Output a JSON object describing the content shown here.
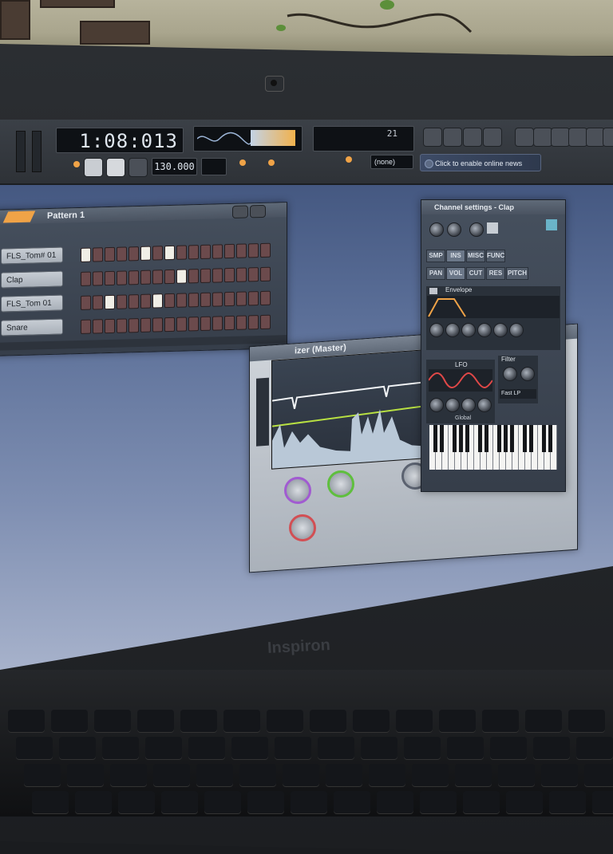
{
  "toolbar": {
    "time": "1:08:013",
    "tempo": "130.000",
    "channel_preset": "(none)",
    "news": "Click to enable online news",
    "hint_top": "21"
  },
  "pattern": {
    "title": "Pattern 1",
    "channels": [
      {
        "name": "FLS_Tom# 01",
        "steps": [
          1,
          0,
          0,
          0,
          0,
          1,
          0,
          1,
          0,
          0,
          0,
          0,
          0,
          0,
          0,
          0
        ]
      },
      {
        "name": "Clap",
        "steps": [
          0,
          0,
          0,
          0,
          0,
          0,
          0,
          0,
          1,
          0,
          0,
          0,
          0,
          0,
          0,
          0
        ]
      },
      {
        "name": "FLS_Tom 01",
        "steps": [
          0,
          0,
          1,
          0,
          0,
          0,
          1,
          0,
          0,
          0,
          0,
          0,
          0,
          0,
          0,
          0
        ]
      },
      {
        "name": "Snare",
        "steps": [
          0,
          0,
          0,
          0,
          0,
          0,
          0,
          0,
          0,
          0,
          0,
          0,
          0,
          0,
          0,
          0
        ]
      }
    ]
  },
  "channel_settings": {
    "title": "Channel settings - Clap",
    "tabs_row1": [
      "SMP",
      "INS",
      "MISC",
      "FUNC"
    ],
    "tabs_row2": [
      "PAN",
      "VOL",
      "CUT",
      "RES",
      "PITCH"
    ],
    "envelope_label": "Envelope",
    "lfo_label": "LFO",
    "filter_label": "Filter",
    "filter_type": "Fast LP",
    "global_label": "Global"
  },
  "mixer": {
    "title": "izer (Master)"
  },
  "laptop": {
    "brand": "Inspiron"
  },
  "colors": {
    "accent_orange": "#f0a347",
    "step_off": "#6b4a4c",
    "step_on": "#f0eee6"
  }
}
